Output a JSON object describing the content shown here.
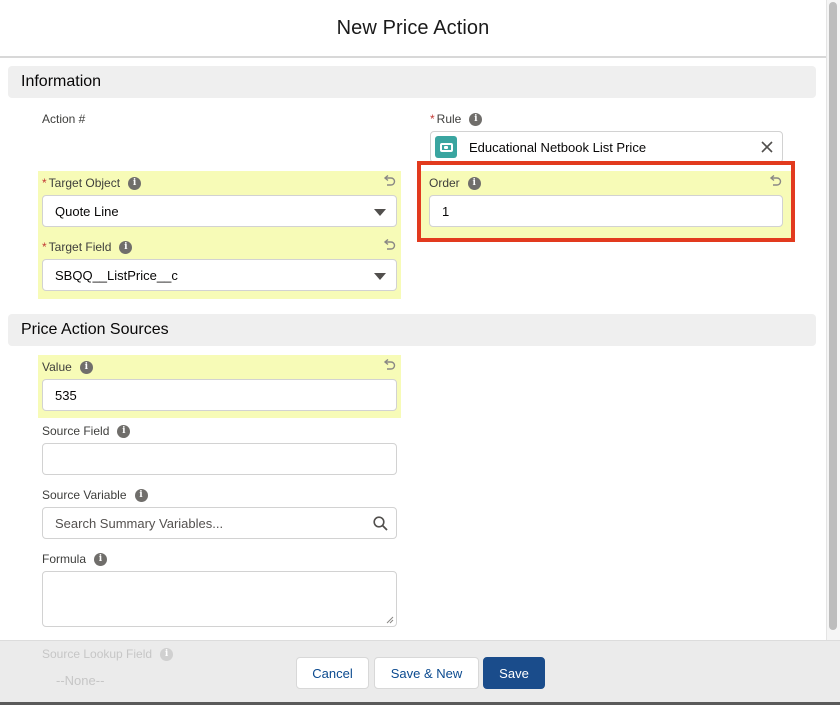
{
  "modal": {
    "title": "New Price Action"
  },
  "sections": {
    "information": "Information",
    "sources": "Price Action Sources"
  },
  "fields": {
    "action_number": {
      "label": "Action #"
    },
    "rule": {
      "label": "Rule",
      "required": "*",
      "value": "Educational Netbook List Price",
      "icon": "price-rule-icon",
      "clear_icon": "close-icon"
    },
    "target_object": {
      "label": "Target Object",
      "required": "*",
      "value": "Quote Line"
    },
    "target_field": {
      "label": "Target Field",
      "required": "*",
      "value": "SBQQ__ListPrice__c"
    },
    "order": {
      "label": "Order",
      "value": "1"
    },
    "value": {
      "label": "Value",
      "value": "535"
    },
    "source_field": {
      "label": "Source Field",
      "value": ""
    },
    "source_variable": {
      "label": "Source Variable",
      "placeholder": "Search Summary Variables...",
      "icon": "search-icon"
    },
    "formula": {
      "label": "Formula",
      "value": ""
    },
    "source_lookup_field": {
      "label": "Source Lookup Field",
      "value": "--None--"
    }
  },
  "info_glyph": "i",
  "footer": {
    "cancel": "Cancel",
    "save_new": "Save & New",
    "save": "Save"
  },
  "colors": {
    "highlight": "#f7fbb7",
    "primary_button": "#1a4c8b",
    "annotation_box": "#e23a1e",
    "rule_icon": "#3aa5a0",
    "required": "#c23934"
  }
}
